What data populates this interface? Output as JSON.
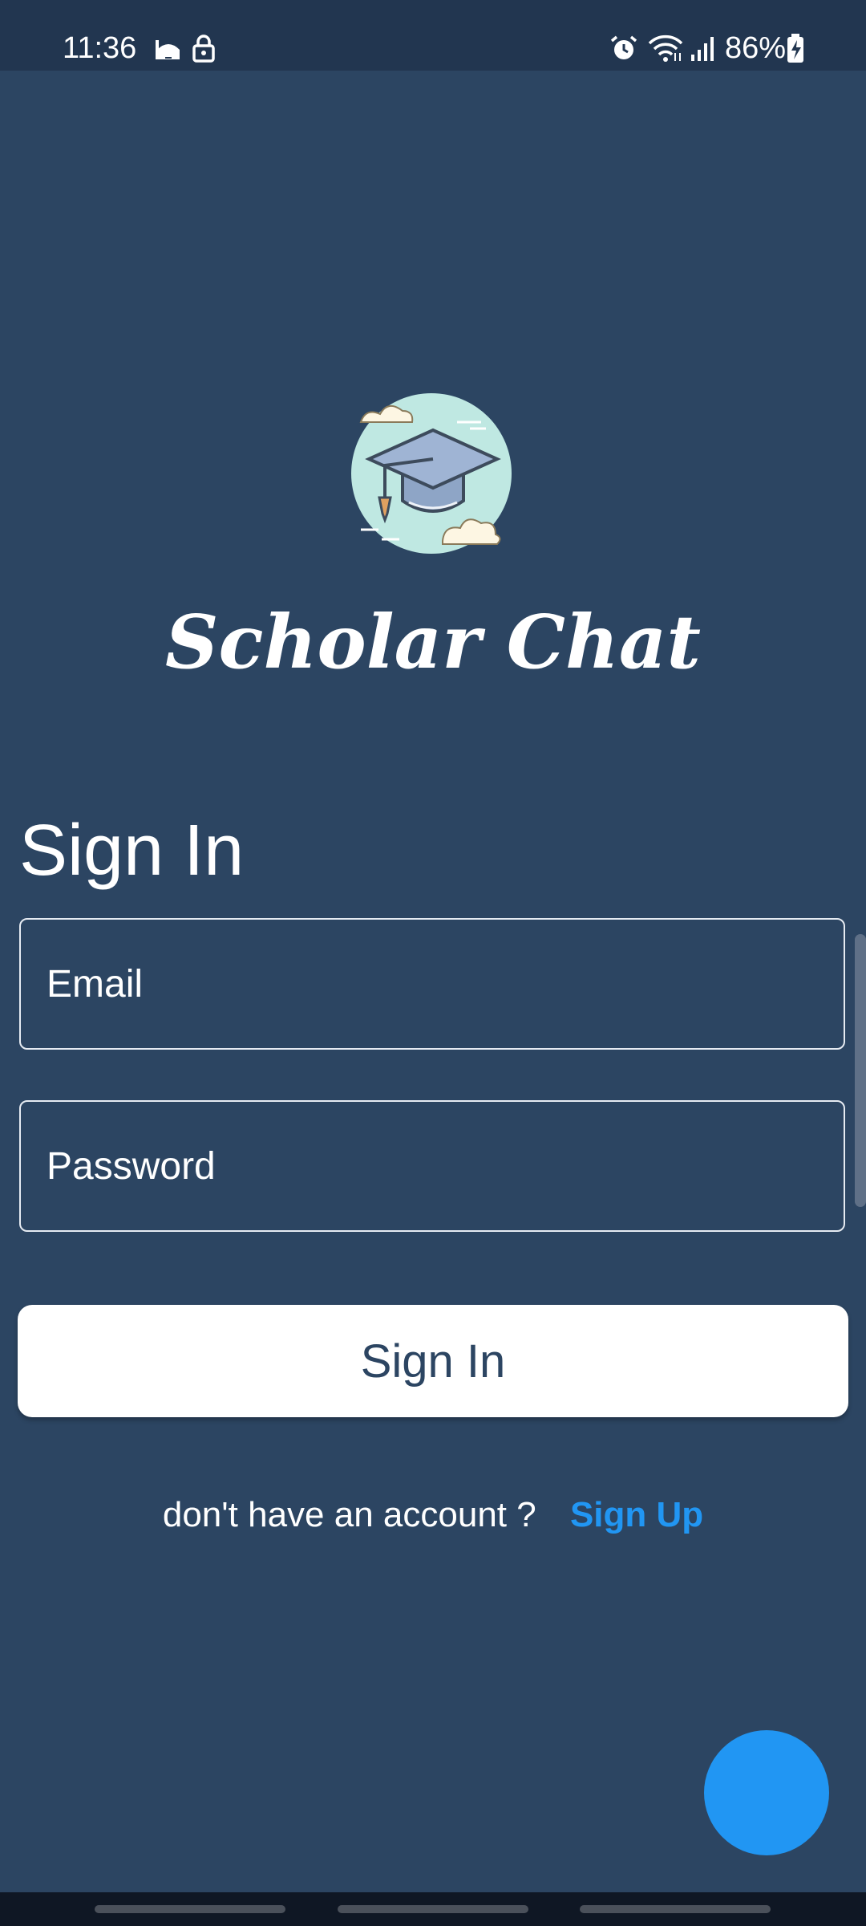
{
  "status_bar": {
    "time": "11:36",
    "battery": "86%",
    "icons": [
      "mosque-icon",
      "lock-icon",
      "alarm-icon",
      "wifi-icon",
      "signal-icon",
      "battery-charging-icon"
    ]
  },
  "app": {
    "title": "Scholar Chat",
    "logo_icon": "graduation-cap-icon"
  },
  "form": {
    "heading": "Sign In",
    "email_placeholder": "Email",
    "password_placeholder": "Password",
    "submit_label": "Sign In"
  },
  "signup": {
    "text": "don't have an account ?",
    "link_label": "Sign Up"
  },
  "colors": {
    "background": "#2c4562",
    "accent": "#2196f3",
    "button_bg": "#ffffff"
  }
}
